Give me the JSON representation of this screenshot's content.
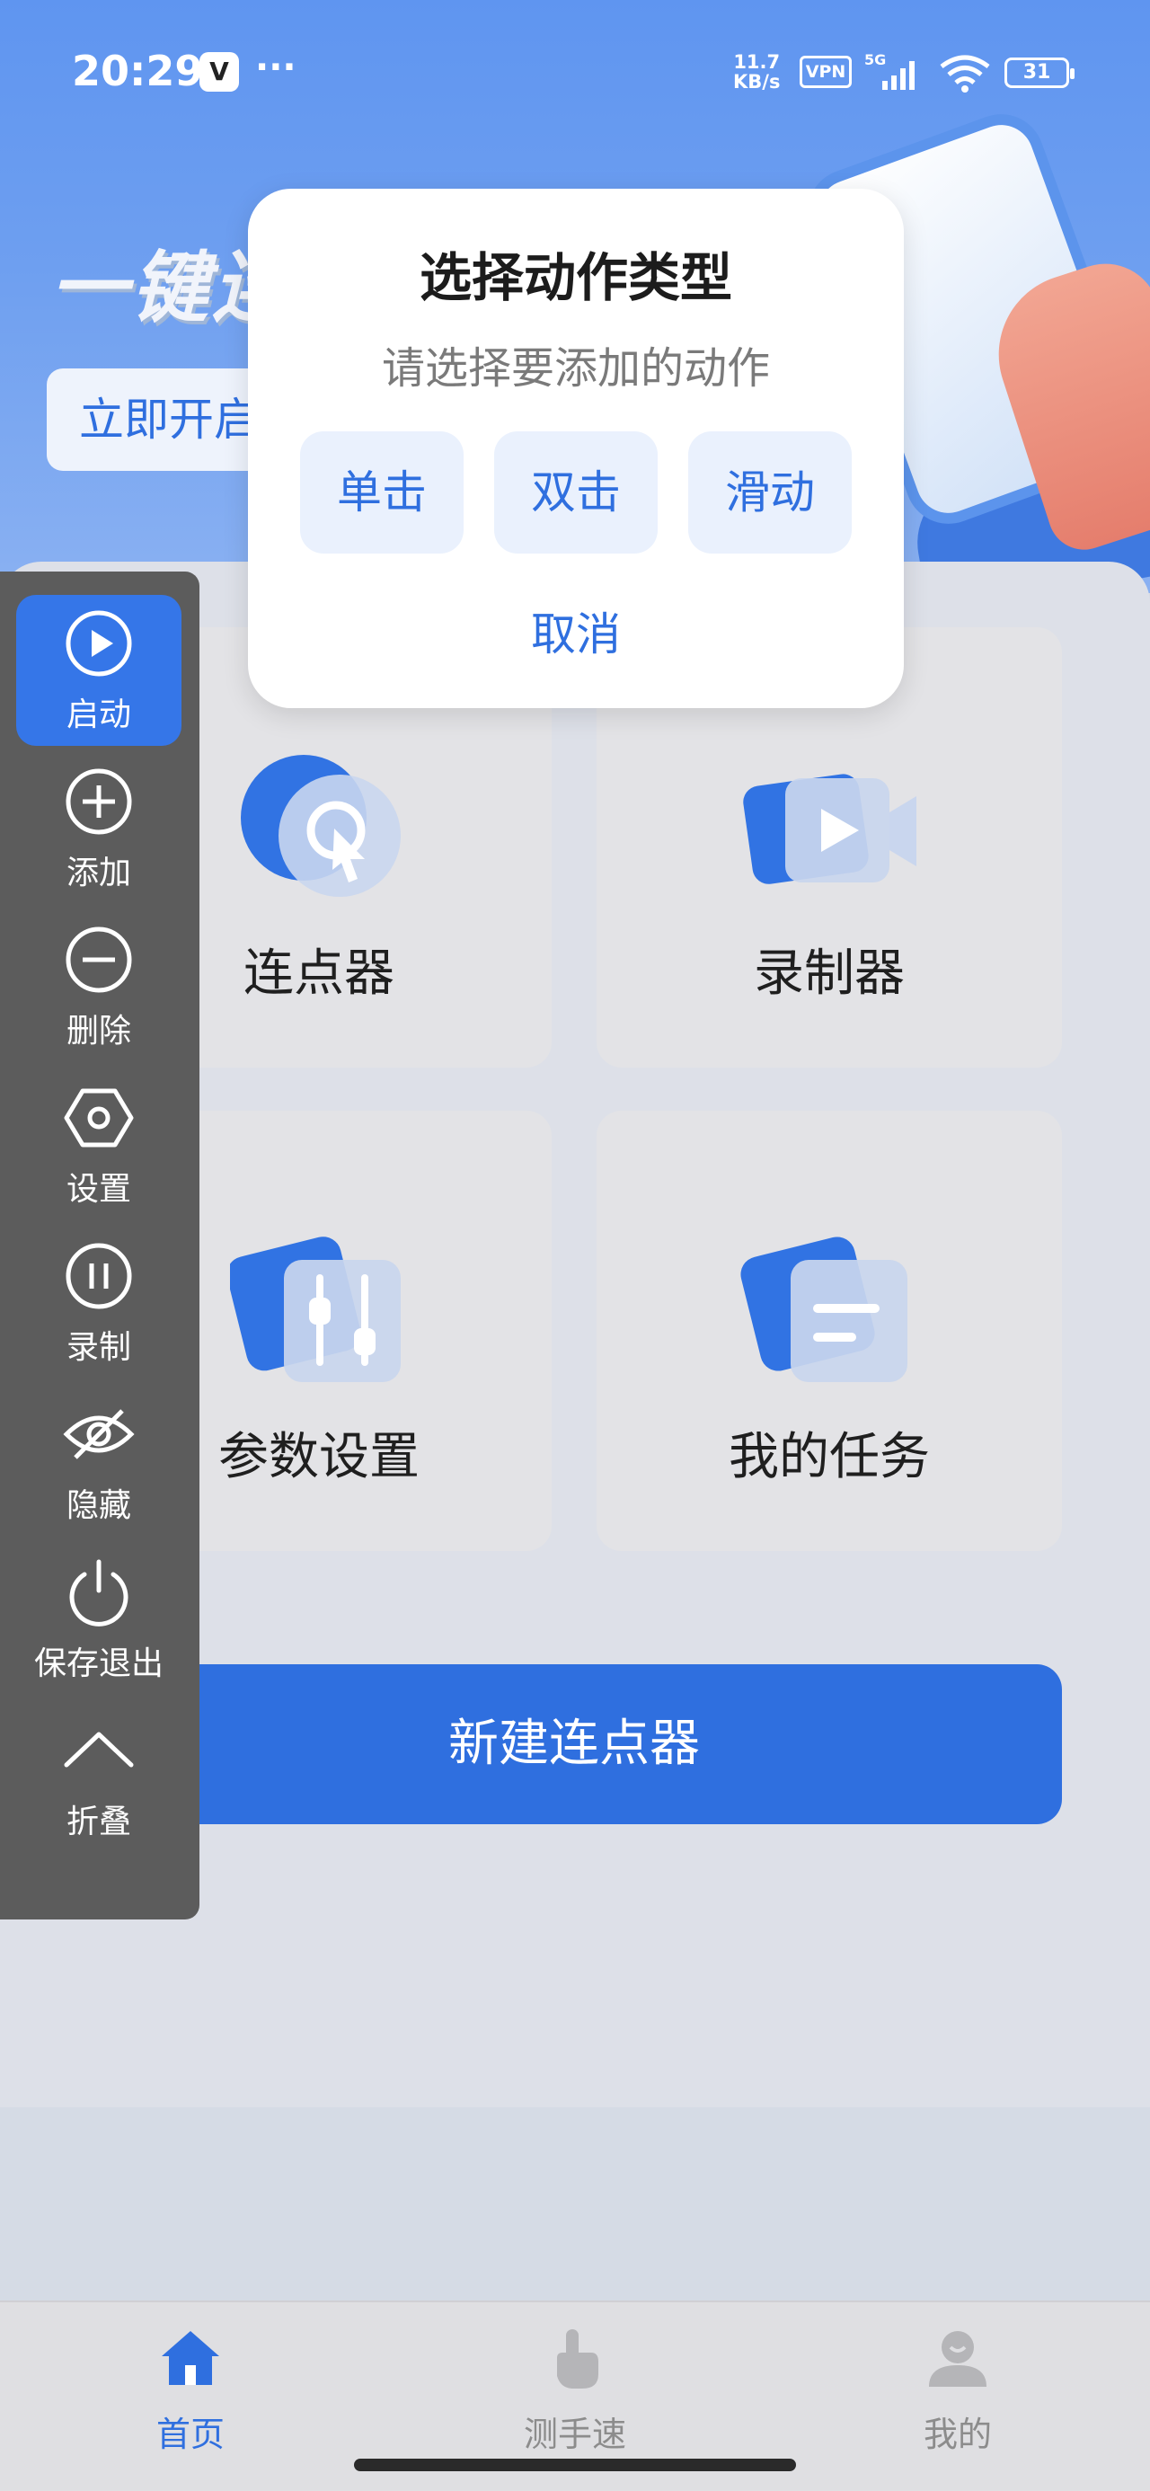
{
  "status_bar": {
    "time": "20:29",
    "app_icon_glyph": "V",
    "more": "···",
    "net_speed_value": "11.7",
    "net_speed_unit": "KB/s",
    "vpn": "VPN",
    "network": "5G",
    "battery": "31"
  },
  "hero": {
    "title": "一键连",
    "start_button": "立即开启"
  },
  "tiles": [
    {
      "label": "连点器",
      "icon": "cursor-click-icon"
    },
    {
      "label": "录制器",
      "icon": "video-camera-icon"
    },
    {
      "label": "参数设置",
      "icon": "sliders-icon"
    },
    {
      "label": "我的任务",
      "icon": "task-list-icon"
    }
  ],
  "new_button": "新建连点器",
  "floating_toolbar": [
    {
      "label": "启动",
      "icon": "play-icon",
      "active": true
    },
    {
      "label": "添加",
      "icon": "plus-circle-icon"
    },
    {
      "label": "删除",
      "icon": "minus-circle-icon"
    },
    {
      "label": "设置",
      "icon": "hexagon-gear-icon"
    },
    {
      "label": "录制",
      "icon": "pause-circle-icon"
    },
    {
      "label": "隐藏",
      "icon": "eye-off-icon"
    },
    {
      "label": "保存退出",
      "icon": "power-icon"
    },
    {
      "label": "折叠",
      "icon": "chevron-up-icon"
    }
  ],
  "dialog": {
    "title": "选择动作类型",
    "subtitle": "请选择要添加的动作",
    "options": [
      "单击",
      "双击",
      "滑动"
    ],
    "cancel": "取消"
  },
  "bottom_nav": [
    {
      "label": "首页",
      "icon": "home-icon",
      "active": true
    },
    {
      "label": "测手速",
      "icon": "tap-hand-icon"
    },
    {
      "label": "我的",
      "icon": "user-icon"
    }
  ],
  "colors": {
    "accent": "#2f6fdf",
    "toolbar_bg": "#5c5c5c",
    "active_toolbar": "#3576e8"
  }
}
